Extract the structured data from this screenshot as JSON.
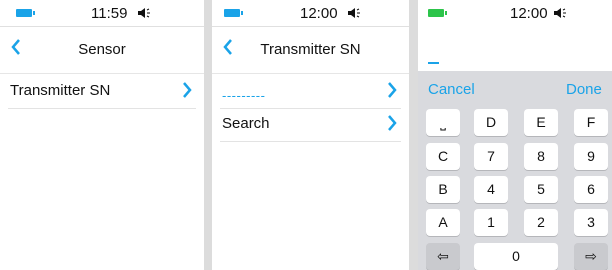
{
  "screens": [
    {
      "status_time": "11:59",
      "title": "Sensor",
      "rows": [
        {
          "label": "Transmitter SN"
        }
      ]
    },
    {
      "status_time": "12:00",
      "title": "Transmitter SN",
      "rows": [
        {
          "label": "---------"
        },
        {
          "label": "Search"
        }
      ]
    },
    {
      "status_time": "12:00",
      "cancel_label": "Cancel",
      "done_label": "Done",
      "keys": {
        "row1": [
          "⎵",
          "D",
          "E",
          "F"
        ],
        "row2": [
          "C",
          "7",
          "8",
          "9"
        ],
        "row3": [
          "B",
          "4",
          "5",
          "6"
        ],
        "row4": [
          "A",
          "1",
          "2",
          "3"
        ],
        "row5": [
          "⇦",
          "0",
          "⇨"
        ]
      }
    }
  ],
  "colors": {
    "accent": "#1aa3e8",
    "battery_green": "#2cc44a",
    "keyboard_bg": "#d9dade"
  }
}
